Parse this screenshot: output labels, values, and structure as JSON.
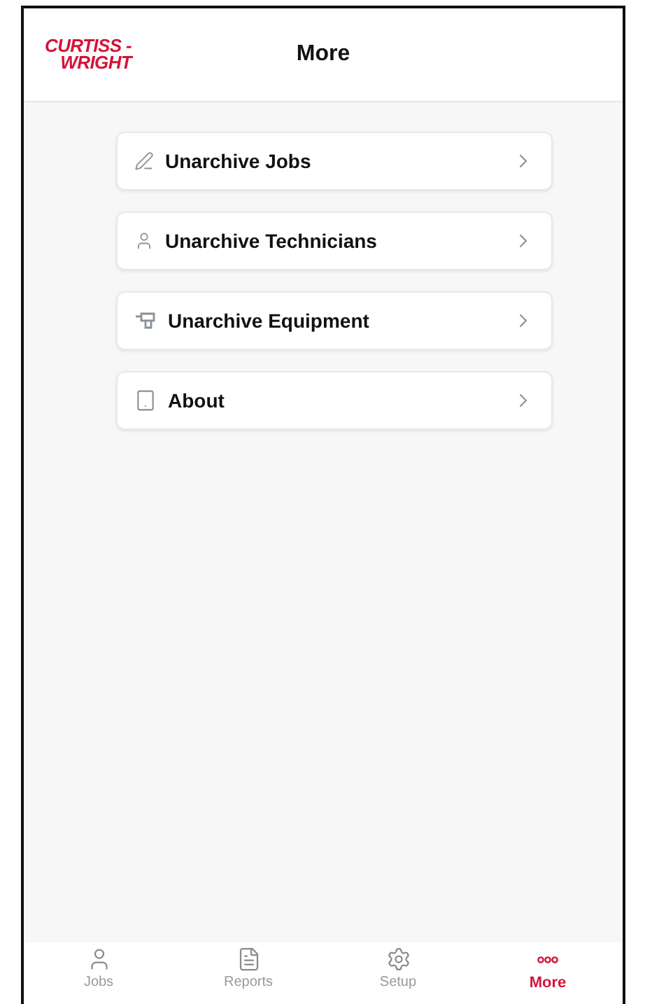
{
  "header": {
    "logo_lines": [
      "CURTISS -",
      "WRIGHT"
    ],
    "title": "More"
  },
  "menu_items": [
    {
      "kind": "jobs",
      "label": "Unarchive Jobs"
    },
    {
      "kind": "technicians",
      "label": "Unarchive Technicians"
    },
    {
      "kind": "equipment",
      "label": "Unarchive Equipment"
    },
    {
      "kind": "about",
      "label": "About"
    }
  ],
  "tab_bar": [
    {
      "kind": "jobs",
      "label": "Jobs",
      "selected": false
    },
    {
      "kind": "reports",
      "label": "Reports",
      "selected": false
    },
    {
      "kind": "setup",
      "label": "Setup",
      "selected": false
    },
    {
      "kind": "more",
      "label": "More",
      "selected": true
    }
  ]
}
